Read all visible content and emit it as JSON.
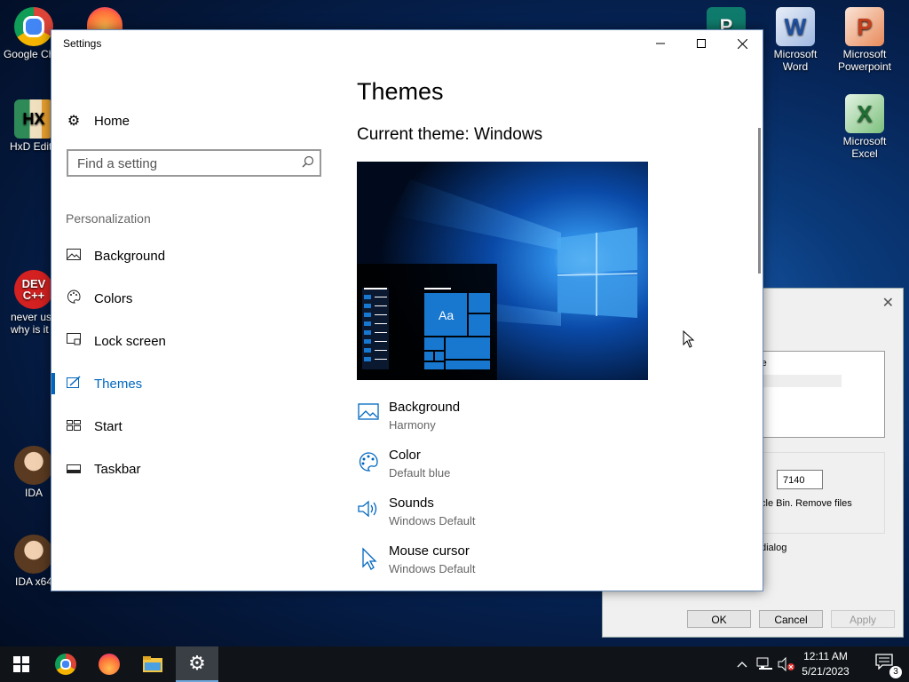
{
  "desktop": {
    "icons": [
      {
        "label": "Google Chro"
      },
      {
        "label": "HxD Edito"
      },
      {
        "label": "never use\nwhy is it ."
      },
      {
        "label": "IDA"
      },
      {
        "label": "IDA x64"
      },
      {
        "label": "Microsoft Word"
      },
      {
        "label": "Microsoft\nPowerpoint"
      },
      {
        "label": "Microsoft Excel"
      }
    ]
  },
  "window": {
    "title": "Settings",
    "minimize": "—",
    "maximize": "☐",
    "close": "✕"
  },
  "nav": {
    "home": "Home",
    "search_placeholder": "Find a setting",
    "section": "Personalization",
    "items": [
      {
        "label": "Background",
        "icon": "picture-icon",
        "selected": false
      },
      {
        "label": "Colors",
        "icon": "palette-icon",
        "selected": false
      },
      {
        "label": "Lock screen",
        "icon": "lock-screen-icon",
        "selected": false
      },
      {
        "label": "Themes",
        "icon": "brush-icon",
        "selected": true
      },
      {
        "label": "Start",
        "icon": "start-icon",
        "selected": false
      },
      {
        "label": "Taskbar",
        "icon": "taskbar-icon",
        "selected": false
      }
    ]
  },
  "main": {
    "title": "Themes",
    "current_theme": "Current theme: Windows",
    "preview_sample": "Aa",
    "properties": [
      {
        "label": "Background",
        "value": "Harmony",
        "icon": "picture-icon"
      },
      {
        "label": "Color",
        "value": "Default blue",
        "icon": "palette-icon"
      },
      {
        "label": "Sounds",
        "value": "Windows Default",
        "icon": "speaker-icon"
      },
      {
        "label": "Mouse cursor",
        "value": "Windows Default",
        "icon": "cursor-icon"
      }
    ]
  },
  "bg_dialog": {
    "list_text": "ailable",
    "number_value": "7140",
    "text1": "cle Bin. Remove files",
    "text2": "dialog",
    "ok": "OK",
    "cancel": "Cancel",
    "apply": "Apply"
  },
  "taskbar": {
    "time": "12:11 AM",
    "date": "5/21/2023",
    "notification_count": "3"
  },
  "colors": {
    "accent": "#0067c0",
    "taskbar": "#101418"
  }
}
